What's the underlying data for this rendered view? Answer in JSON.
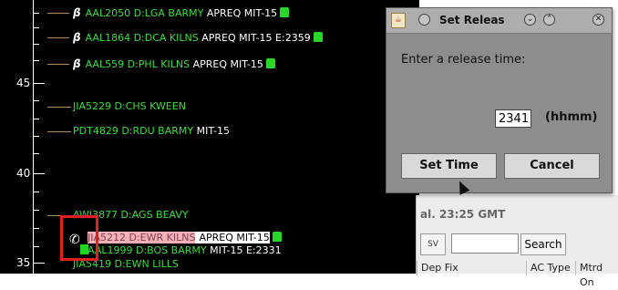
{
  "timeline": {
    "tick_labels": [
      "45",
      "40",
      "35"
    ],
    "flights": [
      {
        "flag_icon": "flag-icon",
        "callsign_origin": "AAL2050 D:LGA BARMY",
        "status": "APREQ MIT-15",
        "eta": "",
        "thumb": true
      },
      {
        "flag_icon": "flag-icon",
        "callsign_origin": "AAL1864 D:DCA KILNS",
        "status": "APREQ MIT-15",
        "eta": "E:2359",
        "thumb": true
      },
      {
        "flag_icon": "flag-icon",
        "callsign_origin": "AAL559 D:PHL KILNS",
        "status": "APREQ MIT-15",
        "eta": "",
        "thumb": true
      },
      {
        "callsign_origin": "JIA5229 D:CHS KWEEN",
        "status": "",
        "eta": "",
        "thumb": false
      },
      {
        "callsign_origin": "PDT4829 D:RDU BARMY",
        "status": "MIT-15",
        "eta": "",
        "thumb": false
      },
      {
        "callsign_origin": "AWI3877 D:AGS BEAVY",
        "status": "",
        "eta": "",
        "thumb": false
      },
      {
        "callsign_origin": "JIA5212 D:EWR KILNS",
        "status": "APREQ MIT-15",
        "eta": "",
        "thumb": true
      },
      {
        "callsign_origin": "AAL1999 D:BOS BARMY",
        "status": "MIT-15",
        "eta": "E:2331",
        "thumb": false
      },
      {
        "callsign_origin": "JIA5419 D:EWN LILLS",
        "status": "",
        "eta": "",
        "thumb": false
      }
    ]
  },
  "background_window": {
    "title_fragment": "al. 23:25 GMT",
    "icon_button": "SV",
    "search_label": "Search",
    "search_value": "",
    "columns": [
      "Dep Fix",
      "AC Type",
      "Mtrd On"
    ]
  },
  "dialog": {
    "title": "Set Releas",
    "prompt": "Enter a release time:",
    "time_value": "2341",
    "unit_label": "(hhmm)",
    "set_button": "Set Time",
    "cancel_button": "Cancel"
  }
}
